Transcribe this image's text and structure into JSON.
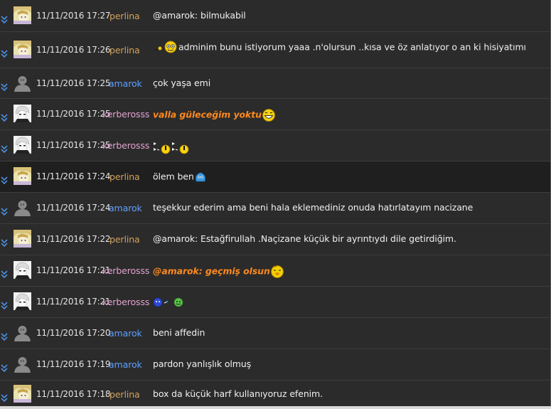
{
  "messages": [
    {
      "time": "11/11/2016 17:27",
      "user": "perlina",
      "text": "@amarok: bilmukabil",
      "emojis_before": [],
      "emojis_after": []
    },
    {
      "time": "11/11/2016 17:26",
      "user": "perlina",
      "text": "adminim bunu istiyorum yaaa .n'olursun ..kısa ve öz anlatıyor o an ki hisiyatımı",
      "emojis_before": [
        "pointing-smiley"
      ],
      "emojis_after": []
    },
    {
      "time": "11/11/2016 17:25",
      "user": "amarok",
      "text": "çok yaşa emi",
      "emojis_before": [],
      "emojis_after": []
    },
    {
      "time": "11/11/2016 17:25",
      "user": "kerberosss",
      "text": "valla güleceğim yoktu",
      "style": "orange",
      "emojis_before": [],
      "emojis_after": [
        "laughing-smiley"
      ]
    },
    {
      "time": "11/11/2016 17:25",
      "user": "kerberosss",
      "text": "",
      "emojis_before": [
        "pacman-eyes",
        "pacman-eyes"
      ],
      "emojis_after": []
    },
    {
      "time": "11/11/2016 17:24",
      "user": "perlina",
      "text": "ölem ben",
      "emojis_before": [],
      "emojis_after": [
        "blue-blob-smiley"
      ]
    },
    {
      "time": "11/11/2016 17:24",
      "user": "amarok",
      "text": "teşekkur ederim ama beni hala eklemediniz onuda hatırlatayım nacizane",
      "emojis_before": [],
      "emojis_after": []
    },
    {
      "time": "11/11/2016 17:22",
      "user": "perlina",
      "text": "@amarok: Estağfirullah .Naçizane küçük bir ayrıntıydı dile getirdiğim.",
      "emojis_before": [],
      "emojis_after": []
    },
    {
      "time": "11/11/2016 17:21",
      "user": "kerberosss",
      "text": "@amarok: geçmiş olsun",
      "style": "orange",
      "emojis_before": [],
      "emojis_after": [
        "sick-smiley"
      ]
    },
    {
      "time": "11/11/2016 17:21",
      "user": "kerberosss",
      "text": "",
      "emojis_before": [
        "blue-green-smileys"
      ],
      "emojis_after": []
    },
    {
      "time": "11/11/2016 17:20",
      "user": "amarok",
      "text": "beni affedin",
      "emojis_before": [],
      "emojis_after": []
    },
    {
      "time": "11/11/2016 17:19",
      "user": "amarok",
      "text": "pardon yanlışlık olmuş",
      "emojis_before": [],
      "emojis_after": []
    },
    {
      "time": "11/11/2016 17:18",
      "user": "perlina",
      "text": "box da küçük harf kullanıyoruz efenim.",
      "emojis_before": [],
      "emojis_after": []
    }
  ],
  "colors": {
    "perlina": "#d4a35a",
    "amarok": "#5fa0ff",
    "kerberosss": "#e3a3d0",
    "highlight_text": "#ff8a1e"
  }
}
